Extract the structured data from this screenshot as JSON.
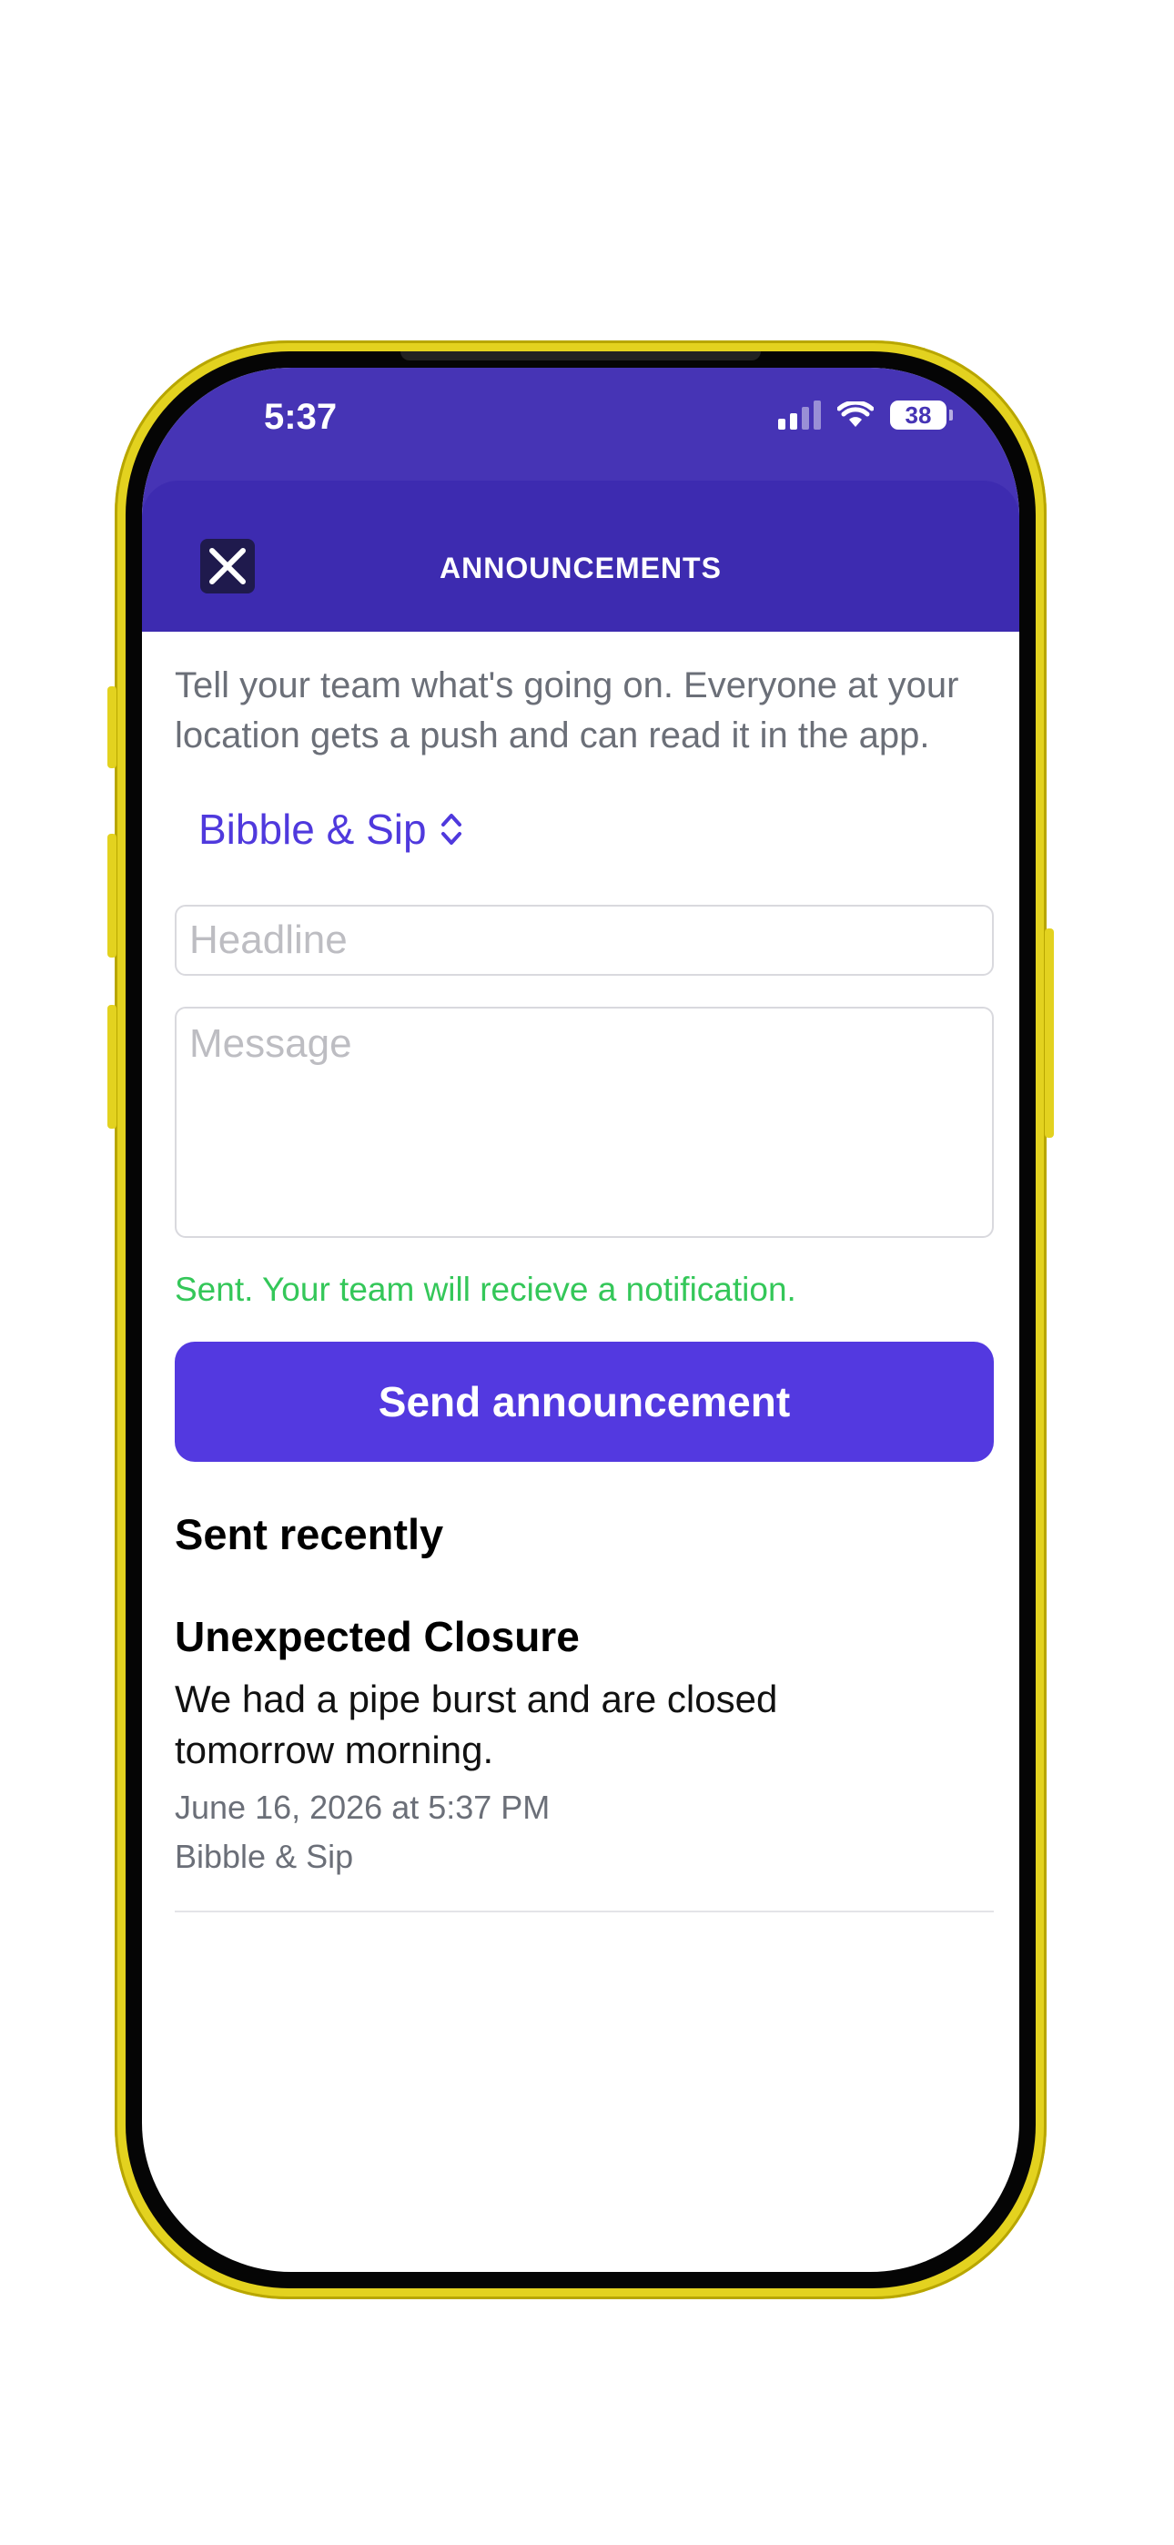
{
  "status_bar": {
    "time": "5:37",
    "battery": "38"
  },
  "header": {
    "title": "ANNOUNCEMENTS"
  },
  "compose": {
    "intro": "Tell your team what's going on. Everyone at your location gets a push and can read it in the app.",
    "location": "Bibble & Sip",
    "headline_placeholder": "Headline",
    "headline_value": "",
    "message_placeholder": "Message",
    "message_value": "",
    "success_message": "Sent. Your team will recieve a notification.",
    "send_label": "Send announcement"
  },
  "recent": {
    "heading": "Sent recently",
    "items": [
      {
        "title": "Unexpected Closure",
        "body": "We had a pipe burst and are closed tomorrow morning.",
        "date": "June 16, 2026 at 5:37 PM",
        "location": "Bibble & Sip"
      }
    ]
  },
  "colors": {
    "header": "#3d2bb0",
    "accent": "#5339e0",
    "success": "#34c759",
    "phone_frame": "#e3d21f"
  }
}
